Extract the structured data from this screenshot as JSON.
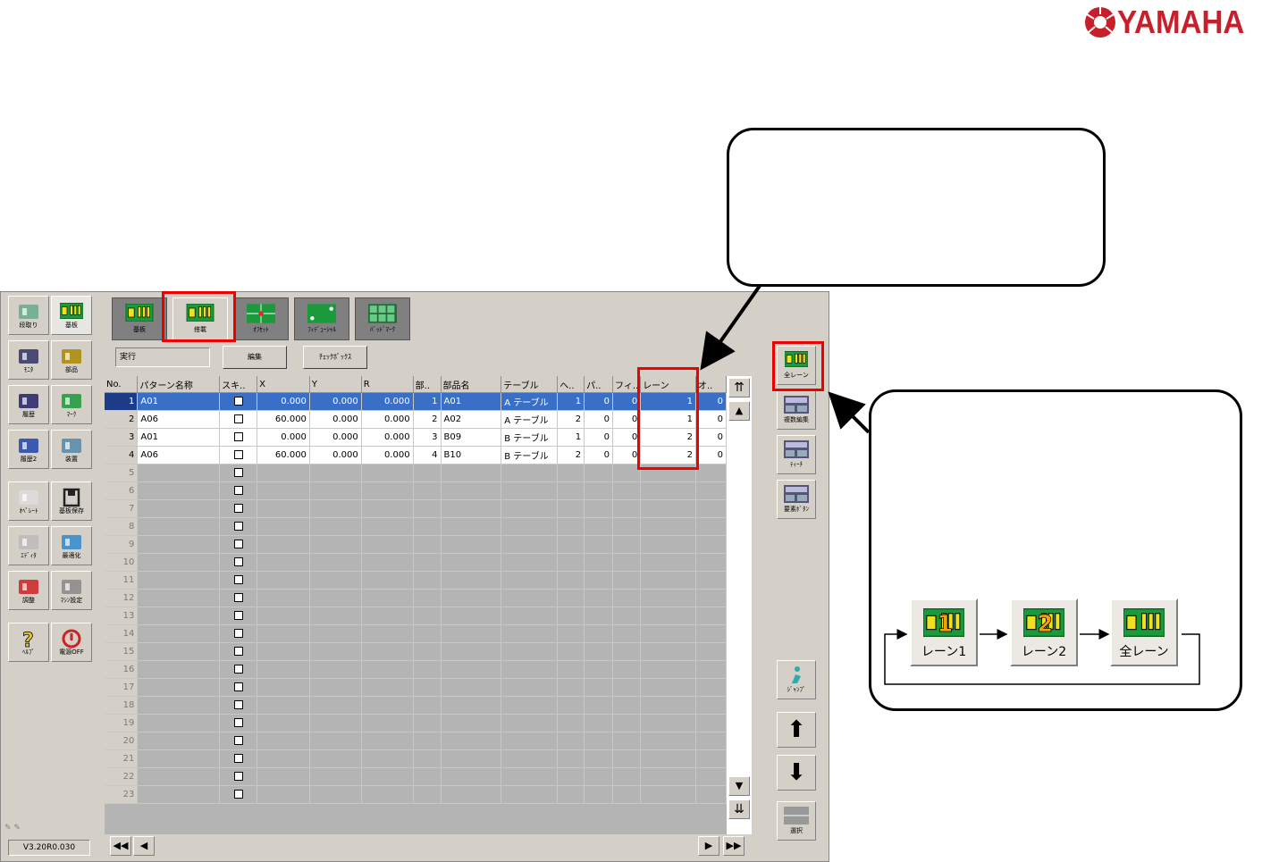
{
  "brand": {
    "name": "YAMAHA",
    "color": "#c8202a"
  },
  "left_toolbar": [
    {
      "label": "段取り",
      "icon": "setup-icon"
    },
    {
      "label": "基板",
      "icon": "board-icon",
      "selected": true
    },
    {
      "label": "ﾓﾆﾀ",
      "icon": "monitor-icon"
    },
    {
      "label": "部品",
      "icon": "parts-icon"
    },
    {
      "label": "履歴",
      "icon": "history-icon"
    },
    {
      "label": "ﾏｰｸ",
      "icon": "mark-icon"
    },
    {
      "label": "履歴2",
      "icon": "history2-icon"
    },
    {
      "label": "装置",
      "icon": "machine-icon"
    },
    {
      "label": "ｵﾍﾟﾚｰﾄ",
      "icon": "operate-icon"
    },
    {
      "label": "基板保存",
      "icon": "save-icon"
    },
    {
      "label": "ｴﾃﾞｨﾀ",
      "icon": "editor-icon"
    },
    {
      "label": "最適化",
      "icon": "optimize-icon"
    },
    {
      "label": "調整",
      "icon": "adjust-icon"
    },
    {
      "label": "ﾏｼﾝ設定",
      "icon": "machine-settings-icon"
    },
    {
      "label": "ﾍﾙﾌﾟ",
      "icon": "help-icon"
    },
    {
      "label": "電源OFF",
      "icon": "power-icon"
    }
  ],
  "version": "V3.20R0.030",
  "tabs": [
    {
      "label": "基板",
      "active": false
    },
    {
      "label": "搭載",
      "active": true
    },
    {
      "label": "ｵﾌｾｯﾄ",
      "active": false
    },
    {
      "label": "ﾌｨﾃﾞｭｰｼｬﾙ",
      "active": false
    },
    {
      "label": "ﾊﾞｯﾄﾞﾏｰｸ",
      "active": false
    }
  ],
  "toolbar": {
    "field_value": "実行",
    "edit_label": "編集",
    "checkbox_label": "ﾁｪｯｸﾎﾞｯｸｽ"
  },
  "table": {
    "columns": [
      "No.",
      "パターン名称",
      "スキ..",
      "X",
      "Y",
      "R",
      "部..",
      "部品名",
      "テーブル",
      "ヘ..",
      "パ..",
      "フィ..",
      "レーン",
      "オ.."
    ],
    "rows": [
      {
        "no": "1",
        "pattern": "A01",
        "x": "0.000",
        "y": "0.000",
        "r": "0.000",
        "part_no": "1",
        "part": "A01",
        "table": "A テーブル",
        "h": "1",
        "p": "0",
        "f": "0",
        "lane": "1",
        "o": "0"
      },
      {
        "no": "2",
        "pattern": "A06",
        "x": "60.000",
        "y": "0.000",
        "r": "0.000",
        "part_no": "2",
        "part": "A02",
        "table": "A テーブル",
        "h": "2",
        "p": "0",
        "f": "0",
        "lane": "1",
        "o": "0"
      },
      {
        "no": "3",
        "pattern": "A01",
        "x": "0.000",
        "y": "0.000",
        "r": "0.000",
        "part_no": "3",
        "part": "B09",
        "table": "B テーブル",
        "h": "1",
        "p": "0",
        "f": "0",
        "lane": "2",
        "o": "0"
      },
      {
        "no": "4",
        "pattern": "A06",
        "x": "60.000",
        "y": "0.000",
        "r": "0.000",
        "part_no": "4",
        "part": "B10",
        "table": "B テーブル",
        "h": "2",
        "p": "0",
        "f": "0",
        "lane": "2",
        "o": "0"
      }
    ],
    "empty_row_numbers": [
      "5",
      "6",
      "7",
      "8",
      "9",
      "10",
      "11",
      "12",
      "13",
      "14",
      "15",
      "16",
      "17",
      "18",
      "19",
      "20",
      "21",
      "22",
      "23"
    ]
  },
  "right_panel": [
    {
      "label": "全レーン",
      "icon": "all-lanes-icon"
    },
    {
      "label": "複数編集",
      "icon": "multi-edit-icon"
    },
    {
      "label": "ﾃｨｰﾁ",
      "icon": "teach-icon"
    },
    {
      "label": "要素ﾎﾞﾀﾝ",
      "icon": "element-icon"
    },
    {
      "label": "ｼﾞｬﾝﾌﾟ",
      "icon": "jump-icon"
    },
    {
      "label": "選択",
      "icon": "select-icon"
    }
  ],
  "lane_cycle": [
    {
      "label": "レーン1",
      "number": "1"
    },
    {
      "label": "レーン2",
      "number": "2"
    },
    {
      "label": "全レーン",
      "number": ""
    }
  ],
  "colors": {
    "highlight": "#e00000",
    "selection": "#3a6fc8",
    "board_green": "#1a9a3a"
  }
}
